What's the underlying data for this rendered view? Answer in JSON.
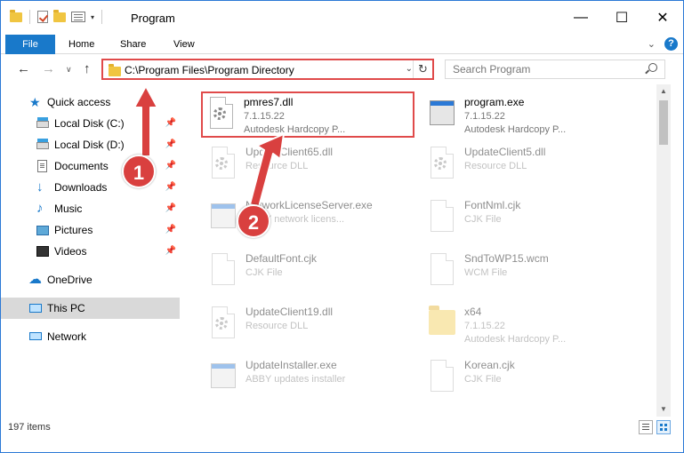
{
  "window": {
    "title": "Program",
    "minimize_glyph": "—",
    "maximize_glyph": "☐",
    "close_glyph": "✕"
  },
  "ribbon": {
    "tabs": [
      {
        "label": "File"
      },
      {
        "label": "Home"
      },
      {
        "label": "Share"
      },
      {
        "label": "View"
      }
    ],
    "help_label": "?"
  },
  "nav": {
    "address": "C:\\Program Files\\Program Directory",
    "search_placeholder": "Search Program"
  },
  "sidebar": {
    "items": [
      {
        "label": "Quick access",
        "icon": "star-icon"
      },
      {
        "label": "Local Disk (C:)",
        "icon": "disk-icon"
      },
      {
        "label": "Local Disk (D:)",
        "icon": "disk-icon"
      },
      {
        "label": "Documents",
        "icon": "documents-icon"
      },
      {
        "label": "Downloads",
        "icon": "downloads-icon"
      },
      {
        "label": "Music",
        "icon": "music-icon"
      },
      {
        "label": "Pictures",
        "icon": "pictures-icon"
      },
      {
        "label": "Videos",
        "icon": "videos-icon"
      },
      {
        "label": "OneDrive",
        "icon": "cloud-icon"
      },
      {
        "label": "This PC",
        "icon": "computer-icon"
      },
      {
        "label": "Network",
        "icon": "network-icon"
      }
    ]
  },
  "files": [
    {
      "name": "pmres7.dll",
      "line1": "7.1.15.22",
      "line2": "Autodesk Hardcopy P...",
      "icon": "dll-gear-icon"
    },
    {
      "name": "program.exe",
      "line1": "7.1.15.22",
      "line2": "Autodesk Hardcopy P...",
      "icon": "exe-icon"
    },
    {
      "name": "UpdateClient65.dll",
      "line1": "Resource DLL",
      "line2": "",
      "icon": "dll-gear-icon"
    },
    {
      "name": "UpdateClient5.dll",
      "line1": "Resource DLL",
      "line2": "",
      "icon": "dll-gear-icon"
    },
    {
      "name": "NetworkLicenseServer.exe",
      "line1": "BBYY network licens...",
      "line2": "",
      "icon": "exe-icon"
    },
    {
      "name": "FontNml.cjk",
      "line1": "CJK File",
      "line2": "",
      "icon": "file-icon"
    },
    {
      "name": "DefaultFont.cjk",
      "line1": "CJK File",
      "line2": "",
      "icon": "file-icon"
    },
    {
      "name": "SndToWP15.wcm",
      "line1": "WCM File",
      "line2": "",
      "icon": "file-icon"
    },
    {
      "name": "UpdateClient19.dll",
      "line1": "Resource DLL",
      "line2": "",
      "icon": "dll-gear-icon"
    },
    {
      "name": "x64",
      "line1": "7.1.15.22",
      "line2": "Autodesk Hardcopy P...",
      "icon": "folder-icon"
    },
    {
      "name": "UpdateInstaller.exe",
      "line1": "ABBY updates installer",
      "line2": "",
      "icon": "exe-icon"
    },
    {
      "name": "Korean.cjk",
      "line1": "CJK File",
      "line2": "",
      "icon": "file-icon"
    }
  ],
  "status": {
    "count": "197 items"
  },
  "annotations": {
    "step1": "1",
    "step2": "2"
  },
  "colors": {
    "accent": "#1979ca",
    "highlight_red": "#e04a4a",
    "badge_red": "#d9403f"
  }
}
